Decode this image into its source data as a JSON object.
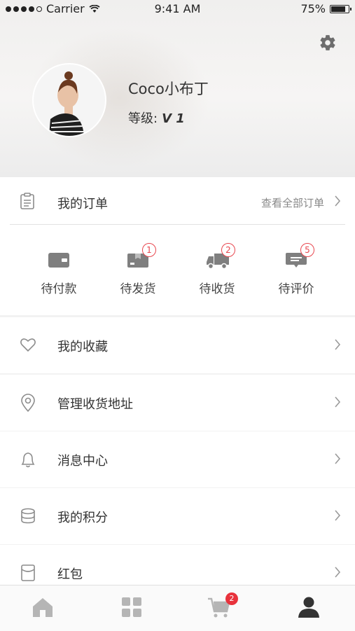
{
  "status_bar": {
    "carrier": "Carrier",
    "time": "9:41 AM",
    "battery": "75%"
  },
  "profile": {
    "name": "Coco小布丁",
    "level_label": "等级:",
    "level_value": "V 1"
  },
  "orders": {
    "title": "我的订单",
    "view_all": "查看全部订单",
    "items": [
      {
        "label": "待付款",
        "icon": "wallet-icon",
        "badge": ""
      },
      {
        "label": "待发货",
        "icon": "package-icon",
        "badge": "1"
      },
      {
        "label": "待收货",
        "icon": "truck-icon",
        "badge": "2"
      },
      {
        "label": "待评价",
        "icon": "comment-icon",
        "badge": "5"
      }
    ]
  },
  "menu": [
    {
      "label": "我的收藏",
      "icon": "heart-icon"
    },
    {
      "label": "管理收货地址",
      "icon": "location-pin-icon"
    },
    {
      "label": "消息中心",
      "icon": "bell-icon"
    },
    {
      "label": "我的积分",
      "icon": "coins-icon"
    },
    {
      "label": "红包",
      "icon": "red-envelope-icon"
    }
  ],
  "tabbar": {
    "tabs": [
      {
        "name": "home",
        "icon": "home-icon"
      },
      {
        "name": "category",
        "icon": "grid-icon"
      },
      {
        "name": "cart",
        "icon": "cart-icon",
        "badge": "2"
      },
      {
        "name": "profile",
        "icon": "user-icon",
        "active": true
      }
    ]
  },
  "colors": {
    "accent_red": "#e8474f",
    "icon_gray": "#8c8c8c",
    "active_tab": "#333333"
  }
}
